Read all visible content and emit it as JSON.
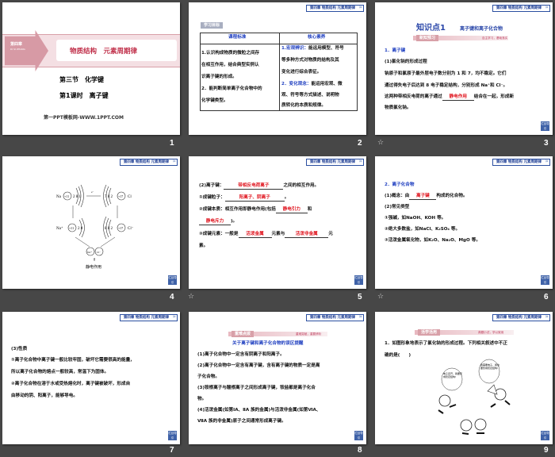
{
  "header_badge": "第四章 物质结构 元素周期律",
  "nav_button": "栏目导引",
  "slide_numbers": [
    "1",
    "2",
    "3",
    "4",
    "5",
    "6",
    "7",
    "8",
    "9"
  ],
  "animation_icon": "star-icon",
  "s1": {
    "chapter": "第四章",
    "chapter_pinyin": "DI SI ZHANG",
    "title": "物质结构　元素周期律",
    "section": "第三节　化学键",
    "lesson": "第1课时　离子键",
    "footer": "第一PPT模板网-WWW.1PPT.COM"
  },
  "s2": {
    "tag": "学习目标",
    "col1": "课程标准",
    "col2": "核心素养",
    "left": [
      "1.认识构成物质的微粒之间存",
      "在相互作用，结合典型实例认",
      "识离子键的形成。",
      "2．能判断简单离子化合物中的",
      "化学键类型。"
    ],
    "r1_label": "1.宏观辨识：",
    "r1": [
      "能运用模型、符号",
      "等多种方式对物质的结构及其",
      "变化进行综合表征。"
    ],
    "r2_label": "2．变化观念：",
    "r2": [
      "能运用宏观、微",
      "观、符号等方式描述、说明物",
      "质转化的本质和规律。"
    ]
  },
  "s3": {
    "kp": "知识点1",
    "kp_title": "离子键和离子化合物",
    "bar": "新知预习",
    "bar_note": "自主学习，基础落实",
    "h1": "1．离子键",
    "sub": "(1)氯化钠的形成过程",
    "l1": "钠原子和氯原子最外层电子数分别为 1 和 7，均不稳定。它们",
    "l2": "通过得失电子后达到 8 电子稳定结构，分别形成 Na⁺和 Cl⁻。",
    "l3a": "这两种带相反电荷的离子通过",
    "l3b": "静电作用",
    "l3c": "结合在一起，形成新",
    "l4": "物质氯化钠。"
  },
  "s4": {
    "na": "Na",
    "cl": "Cl",
    "na_ion": "Na⁺",
    "cl_ion": "Cl⁻",
    "na_nuc": "+11",
    "cl_nuc": "+17",
    "na_shell": "2 8 1",
    "cl_shell": "7 8 2",
    "na_ion_shell": "2 8",
    "cl_ion_shell": "8 8 2",
    "electron": "e⁻",
    "label": "静电作用"
  },
  "s5": {
    "l1a": "(2)离子键：",
    "l1b": "带相反电荷离子",
    "l1c": "之间的相互作用。",
    "l2a": "①成键粒子：",
    "l2b": "阳离子、阴离子",
    "l2c": "。",
    "l3a": "②成键本质：相互作用即静电作用(包括",
    "l3b": "静电引力",
    "l3c": "和",
    "l4a": "静电斥力",
    "l4b": ")。",
    "l5a": "③成键元素：一般是",
    "l5b": "活泼金属",
    "l5c": "元素与",
    "l5d": "活泼非金属",
    "l5e": "元",
    "l6": "素。"
  },
  "s6": {
    "h": "2．离子化合物",
    "l1a": "(1)概念：由",
    "l1b": "离子键",
    "l1c": "构成的化合物。",
    "l2": "(2)常见类型",
    "l3": "①强碱，如NaOH、KOH 等。",
    "l4": "②绝大多数盐，如NaCl、K₂SO₄ 等。",
    "l5": "③活泼金属氧化物，如K₂O、Na₂O、MgO 等。"
  },
  "s7": {
    "h": "(3)性质",
    "lines": [
      "①离子化合物中离子键一般比较牢固，破坏它需要很高的能量，",
      "所以离子化合物的熔点一般较高，常温下为固体。",
      "②离子化合物在溶于水或受热熔化时，离子键被破坏，形成自",
      "由移动的阴、阳离子，能够导电。"
    ]
  },
  "s8": {
    "bar": "重难点拨",
    "bar_note": "重难突破，重要辨析",
    "title": "关于离子键和离子化合物的误区提醒",
    "lines": [
      "(1)离子化合物中一定含有阴离子和阳离子。",
      "(2)离子化合物中一定含有离子键，含有离子键的物质一定是离",
      "子化合物。",
      "(3)铵根离子与酸根离子之间形成离子键，铵盐都是离子化合",
      "物。",
      "(4)活泼金属(如第ⅠA、ⅡA 族的金属)与活泼非金属(如第ⅥA、",
      "ⅦA 族的非金属)原子之间通常形成离子键。"
    ]
  },
  "s9": {
    "bar": "活学活用",
    "bar_note": "典题小试，学以致用",
    "q1": "1．如图形象地表示了氯化钠的形成过程。下列相关叙述中不正",
    "q2": "确的是(　　)",
    "bubble1": "电子走开，我要形成稳定结构!",
    "bubble2": "我需要电子，我也要形成稳定结构!"
  }
}
